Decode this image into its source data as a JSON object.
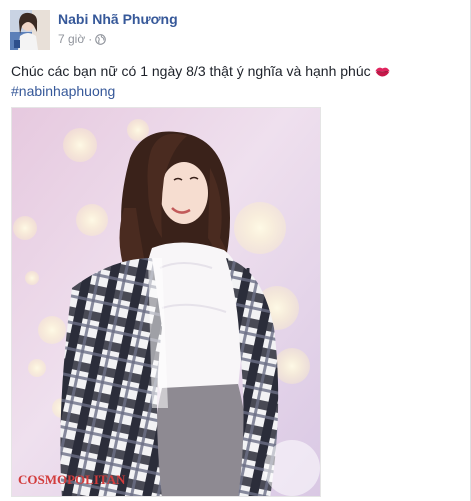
{
  "post": {
    "author": "Nabi Nhã Phương",
    "timestamp": "7 giờ",
    "separator": "·",
    "privacy_icon": "globe-icon",
    "text_line1": "Chúc các bạn nữ có 1 ngày 8/3 thật ý nghĩa và hạnh phúc",
    "emoji_icon": "kiss-lips-icon",
    "hashtag": "#nabinhaphuong",
    "photo": {
      "watermark": "COSMOPOLITAN"
    }
  },
  "colors": {
    "link": "#365899",
    "text": "#1d2129",
    "meta": "#90949c",
    "watermark": "#d23c3c"
  }
}
